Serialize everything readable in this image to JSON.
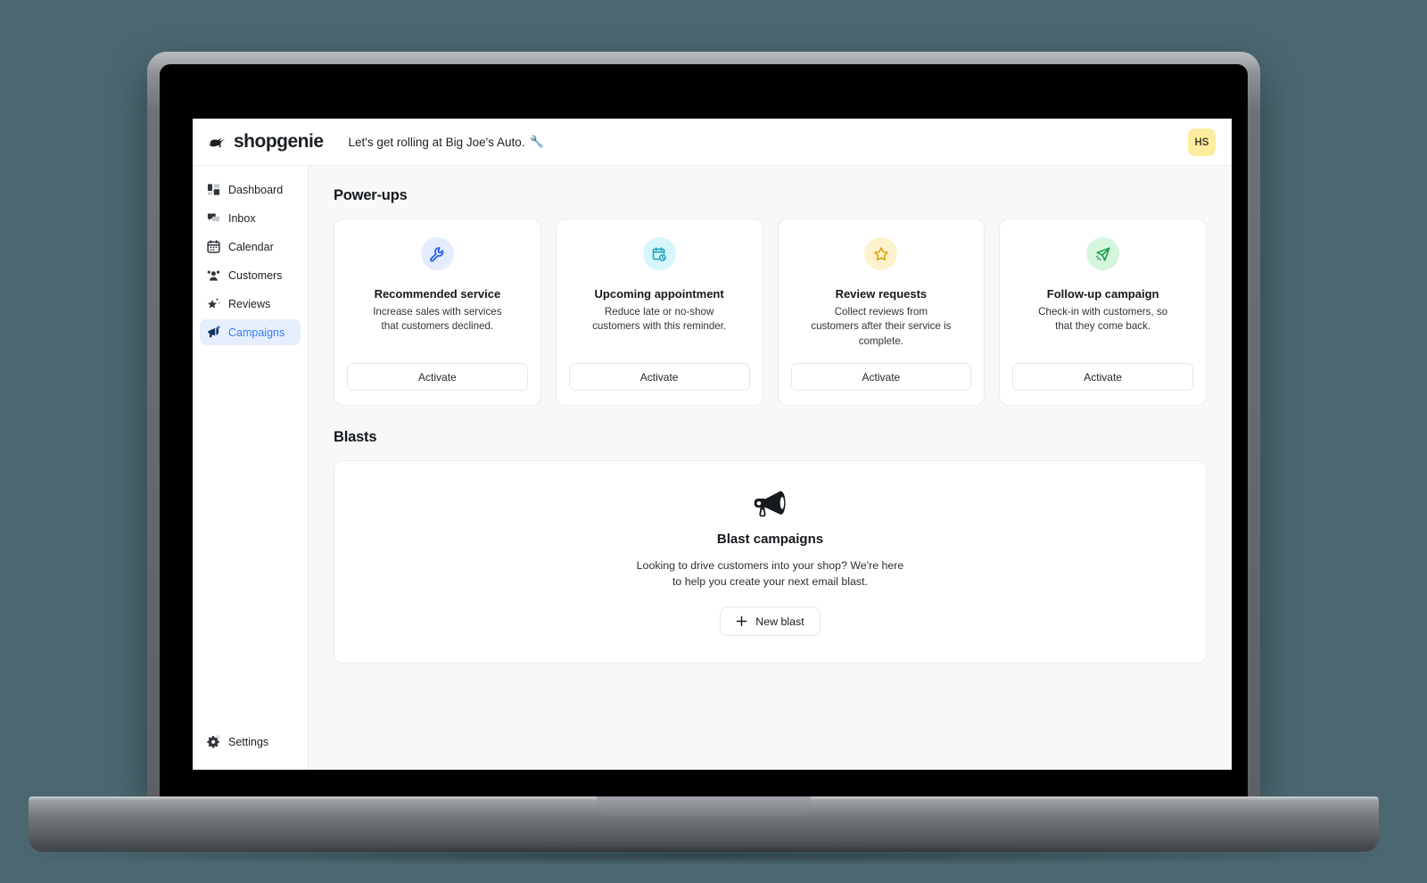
{
  "app": {
    "brand_name": "shopgenie",
    "brand_icon": "genie-lamp-icon",
    "greeting": "Let's get rolling at Big Joe's Auto.",
    "greeting_emoji": "🔧",
    "avatar_initials": "HS",
    "accent_color": "#3b7ef5",
    "page_bg_color": "#f7f8f8",
    "desktop_bg_color": "#4b6770",
    "avatar_bg_color": "#fceda0"
  },
  "sidebar": {
    "items": [
      {
        "label": "Dashboard",
        "icon": "dashboard-icon",
        "active": false
      },
      {
        "label": "Inbox",
        "icon": "inbox-chat-icon",
        "active": false
      },
      {
        "label": "Calendar",
        "icon": "calendar-icon",
        "active": false
      },
      {
        "label": "Customers",
        "icon": "customers-icon",
        "active": false
      },
      {
        "label": "Reviews",
        "icon": "star-sparkle-icon",
        "active": false
      },
      {
        "label": "Campaigns",
        "icon": "megaphone-icon",
        "active": true
      }
    ],
    "footer": {
      "label": "Settings",
      "icon": "gear-icon"
    }
  },
  "main": {
    "powerups": {
      "heading": "Power-ups",
      "cards": [
        {
          "title": "Recommended service",
          "description": "Increase sales with services that customers declined.",
          "button_label": "Activate",
          "icon": "wrench-icon",
          "icon_color": "#2563eb",
          "icon_bg": "#e4ecfd"
        },
        {
          "title": "Upcoming appointment",
          "description": "Reduce late or no-show customers with this reminder.",
          "button_label": "Activate",
          "icon": "calendar-clock-icon",
          "icon_color": "#1aa3bd",
          "icon_bg": "#d6f6fb"
        },
        {
          "title": "Review requests",
          "description": "Collect reviews from customers after their service is complete.",
          "button_label": "Activate",
          "icon": "star-icon",
          "icon_color": "#d9a81a",
          "icon_bg": "#fdf2cc"
        },
        {
          "title": "Follow-up campaign",
          "description": "Check-in with customers, so that they come back.",
          "button_label": "Activate",
          "icon": "paper-plane-icon",
          "icon_color": "#1f9e4e",
          "icon_bg": "#d6f5dd"
        }
      ]
    },
    "blasts": {
      "heading": "Blasts",
      "empty_state": {
        "icon": "megaphone-icon",
        "title": "Blast campaigns",
        "description_line1": "Looking to drive customers into your shop? We're here",
        "description_line2": "to help you create your next email blast.",
        "button_label": "New blast",
        "button_icon": "plus-icon"
      }
    }
  }
}
